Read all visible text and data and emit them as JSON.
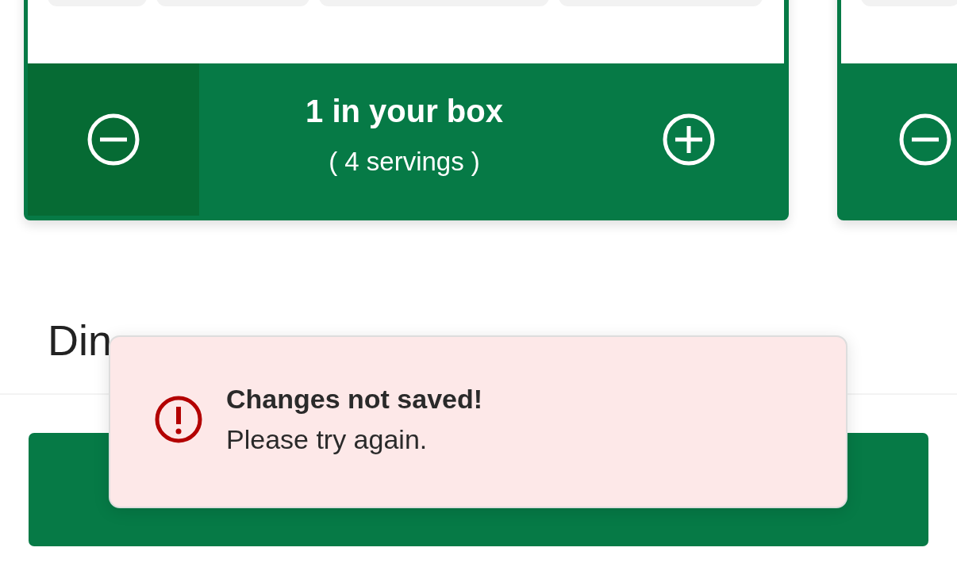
{
  "cards": [
    {
      "kind": "full",
      "quantity": "1 in your box",
      "servings": "( 4 servings )"
    },
    {
      "kind": "clipped"
    }
  ],
  "section": {
    "heading": "Din"
  },
  "continue_button": {
    "kind": "primary"
  },
  "toast": {
    "kind": "error",
    "title": "Changes not saved!",
    "message": "Please try again."
  }
}
